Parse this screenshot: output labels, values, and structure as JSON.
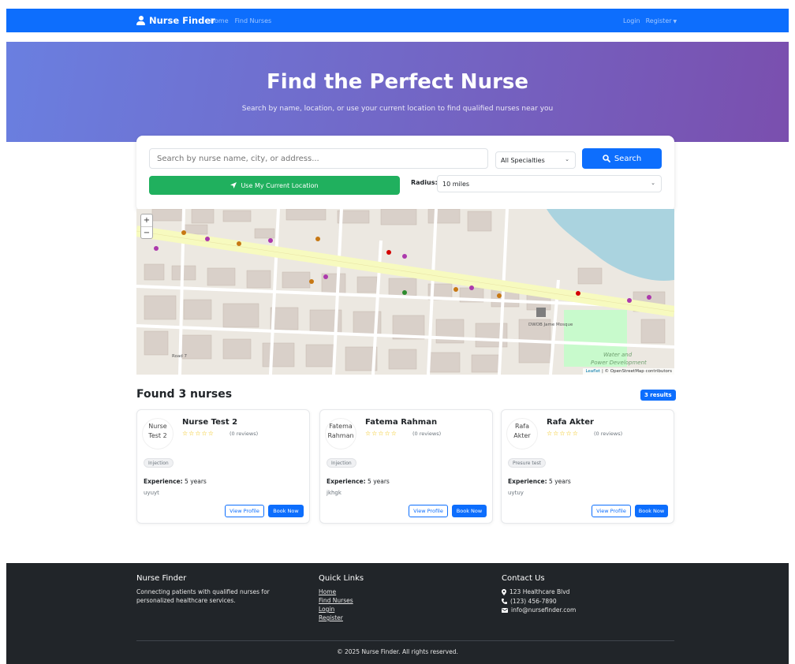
{
  "navbar": {
    "brand": "Nurse Finder",
    "links": [
      "Home",
      "Find Nurses"
    ],
    "login": "Login",
    "register": "Register"
  },
  "hero": {
    "title": "Find the Perfect Nurse",
    "subtitle": "Search by name, location, or use your current location to find qualified nurses near you"
  },
  "search": {
    "placeholder": "Search by nurse name, city, or address...",
    "specialty_selected": "All Specialties",
    "button": "Search",
    "location_button": "Use My Current Location",
    "radius_label": "Radius:",
    "radius_selected": "10 miles"
  },
  "map": {
    "attribution_leaflet": "Leaflet",
    "attribution_osm": "| © OpenStreetMap contributors",
    "labels": {
      "water": "Water and",
      "power": "Power Development",
      "mosque": "DWOB Jame Mosque",
      "road": "Road 7"
    }
  },
  "results": {
    "title": "Found 3 nurses",
    "badge": "3 results"
  },
  "nurses": [
    {
      "avatar_alt": "Nurse Test 2",
      "name": "Nurse Test 2",
      "reviews": "(0 reviews)",
      "specialty": "Injection",
      "experience_label": "Experience:",
      "experience": "5 years",
      "description": "uyuyt",
      "view": "View Profile",
      "book": "Book Now"
    },
    {
      "avatar_alt": "Fatema Rahman",
      "name": "Fatema Rahman",
      "reviews": "(0 reviews)",
      "specialty": "Injection",
      "experience_label": "Experience:",
      "experience": "5 years",
      "description": "jkhgk",
      "view": "View Profile",
      "book": "Book Now"
    },
    {
      "avatar_alt": "Rafa Akter",
      "name": "Rafa Akter",
      "reviews": "(0 reviews)",
      "specialty": "Presure test",
      "experience_label": "Experience:",
      "experience": "5 years",
      "description": "uytuy",
      "view": "View Profile",
      "book": "Book Now"
    }
  ],
  "footer": {
    "about_title": "Nurse Finder",
    "about_text": "Connecting patients with qualified nurses for personalized healthcare services.",
    "links_title": "Quick Links",
    "links": [
      "Home",
      "Find Nurses",
      "Login",
      "Register"
    ],
    "contact_title": "Contact Us",
    "address": "123 Healthcare Blvd",
    "phone": "(123) 456-7890",
    "email": "info@nursefinder.com",
    "copyright": "© 2025 Nurse Finder. All rights reserved."
  },
  "colors": {
    "primary": "#0d6efd",
    "success": "#20b05e",
    "footer_bg": "#212529",
    "star": "#f0c000"
  }
}
